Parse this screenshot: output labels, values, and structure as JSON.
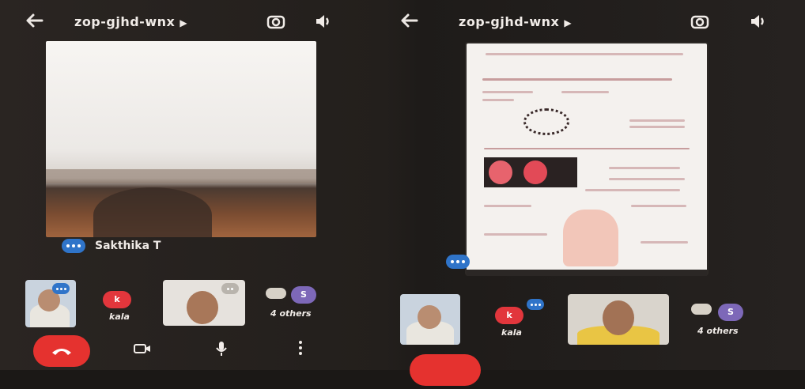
{
  "left": {
    "meeting_code": "zop-gjhd-wnx",
    "speaker_name": "Sakthika T",
    "participants": {
      "kala_initial": "k",
      "kala_name": "kala",
      "others_initial": "S",
      "others_label": "4 others"
    }
  },
  "right": {
    "meeting_code": "zop-gjhd-wnx",
    "participants": {
      "kala_initial": "k",
      "kala_name": "kala",
      "others_initial": "S",
      "others_label": "4 others"
    }
  },
  "icons": {
    "back": "arrow-left-icon",
    "title_caret": "caret-right-icon",
    "camera_switch": "camera-switch-icon",
    "speaker": "speaker-icon",
    "hangup": "phone-hangup-icon",
    "camera": "camera-icon",
    "mic": "mic-icon",
    "more": "more-vertical-icon"
  },
  "colors": {
    "hangup": "#e5322f",
    "audio_indicator": "#2f74c9",
    "avatar_kala": "#e2363c",
    "avatar_others": "#7d68b8"
  }
}
